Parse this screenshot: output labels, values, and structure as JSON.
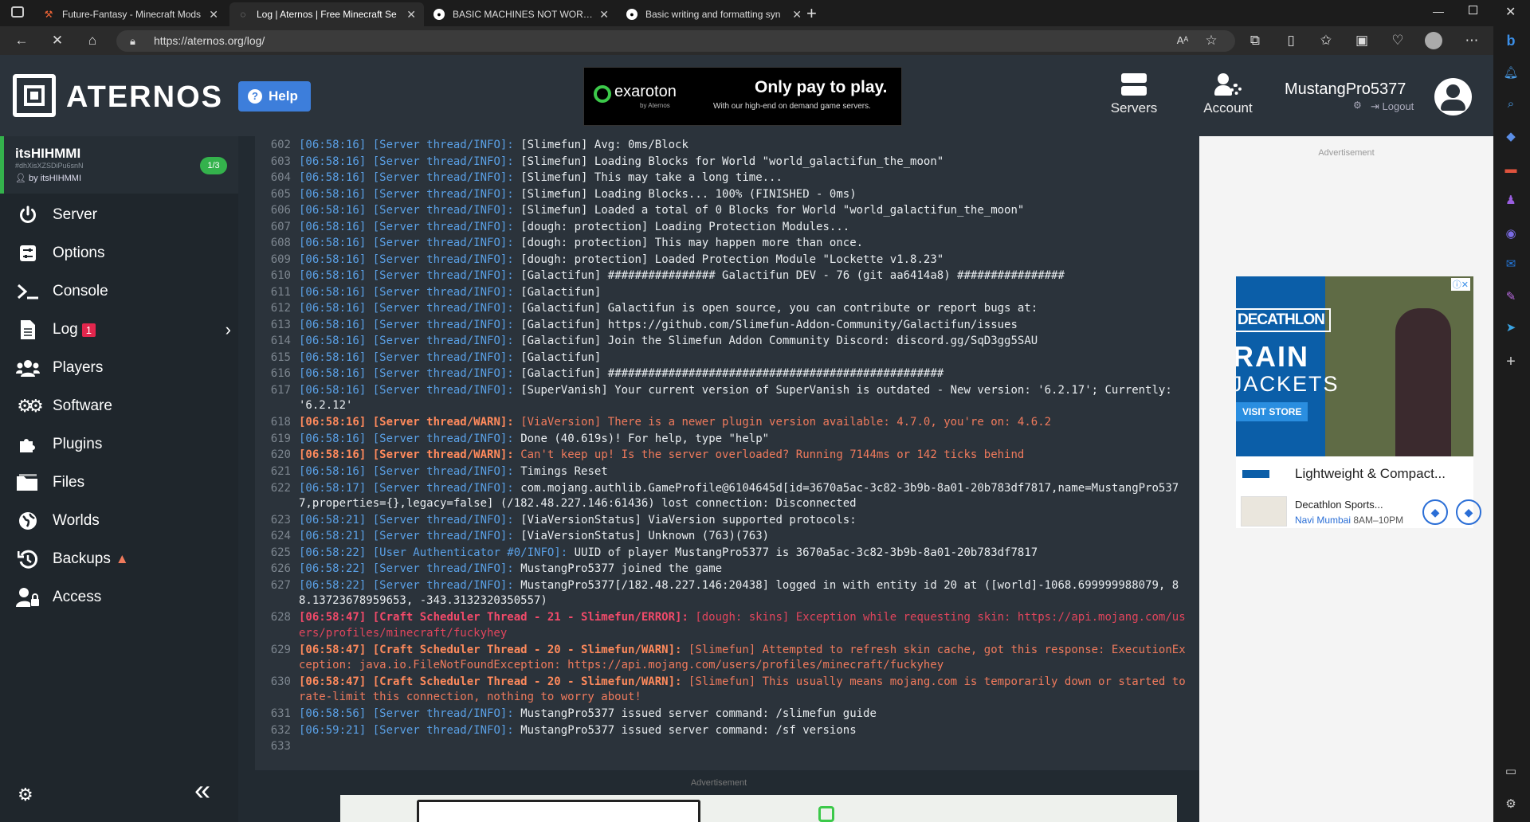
{
  "browser": {
    "tabs": [
      {
        "title": "Future-Fantasy - Minecraft Mods",
        "icon": "curseforge-icon"
      },
      {
        "title": "Log | Aternos | Free Minecraft Se",
        "icon": "loading-icon"
      },
      {
        "title": "BASIC MACHINES NOT WORKING",
        "icon": "github-icon"
      },
      {
        "title": "Basic writing and formatting syn",
        "icon": "github-icon"
      }
    ],
    "url": "https://aternos.org/log/"
  },
  "header": {
    "logo": "ATERNOS",
    "help": "Help",
    "ad": {
      "brand": "exaroton",
      "brand_sub": "by Aternos",
      "headline": "Only pay to play.",
      "sub": "With our high-end on demand game servers."
    },
    "nav": {
      "servers": "Servers",
      "account": "Account"
    },
    "user": {
      "name": "MustangPro5377",
      "logout": "Logout"
    }
  },
  "server": {
    "name": "itsHIHMMI",
    "id": "#dhXisXZSDiPu6snN",
    "owner": "by itsHIHMMI",
    "badge": "1/3"
  },
  "sidebar": {
    "items": [
      {
        "label": "Server",
        "icon": "power-icon"
      },
      {
        "label": "Options",
        "icon": "sliders-icon"
      },
      {
        "label": "Console",
        "icon": "terminal-icon"
      },
      {
        "label": "Log",
        "icon": "document-icon",
        "badge": "1"
      },
      {
        "label": "Players",
        "icon": "users-icon"
      },
      {
        "label": "Software",
        "icon": "gears-icon"
      },
      {
        "label": "Plugins",
        "icon": "puzzle-icon"
      },
      {
        "label": "Files",
        "icon": "folder-icon"
      },
      {
        "label": "Worlds",
        "icon": "globe-icon"
      },
      {
        "label": "Backups",
        "icon": "history-icon"
      },
      {
        "label": "Access",
        "icon": "user-lock-icon"
      }
    ]
  },
  "log": [
    {
      "n": "602",
      "t": "info",
      "ts": "[06:58:16]",
      "src": "[Server thread/INFO]:",
      "msg": "[Slimefun] Avg: 0ms/Block"
    },
    {
      "n": "603",
      "t": "info",
      "ts": "[06:58:16]",
      "src": "[Server thread/INFO]:",
      "msg": "[Slimefun] Loading Blocks for World \"world_galactifun_the_moon\""
    },
    {
      "n": "604",
      "t": "info",
      "ts": "[06:58:16]",
      "src": "[Server thread/INFO]:",
      "msg": "[Slimefun] This may take a long time..."
    },
    {
      "n": "605",
      "t": "info",
      "ts": "[06:58:16]",
      "src": "[Server thread/INFO]:",
      "msg": "[Slimefun] Loading Blocks... 100% (FINISHED - 0ms)"
    },
    {
      "n": "606",
      "t": "info",
      "ts": "[06:58:16]",
      "src": "[Server thread/INFO]:",
      "msg": "[Slimefun] Loaded a total of 0 Blocks for World \"world_galactifun_the_moon\""
    },
    {
      "n": "607",
      "t": "info",
      "ts": "[06:58:16]",
      "src": "[Server thread/INFO]:",
      "msg": "[dough: protection] Loading Protection Modules..."
    },
    {
      "n": "608",
      "t": "info",
      "ts": "[06:58:16]",
      "src": "[Server thread/INFO]:",
      "msg": "[dough: protection] This may happen more than once."
    },
    {
      "n": "609",
      "t": "info",
      "ts": "[06:58:16]",
      "src": "[Server thread/INFO]:",
      "msg": "[dough: protection] Loaded Protection Module \"Lockette v1.8.23\""
    },
    {
      "n": "610",
      "t": "info",
      "ts": "[06:58:16]",
      "src": "[Server thread/INFO]:",
      "msg": "[Galactifun] ################ Galactifun DEV - 76 (git aa6414a8) ################"
    },
    {
      "n": "611",
      "t": "info",
      "ts": "[06:58:16]",
      "src": "[Server thread/INFO]:",
      "msg": "[Galactifun]"
    },
    {
      "n": "612",
      "t": "info",
      "ts": "[06:58:16]",
      "src": "[Server thread/INFO]:",
      "msg": "[Galactifun] Galactifun is open source, you can contribute or report bugs at:"
    },
    {
      "n": "613",
      "t": "info",
      "ts": "[06:58:16]",
      "src": "[Server thread/INFO]:",
      "msg": "[Galactifun] https://github.com/Slimefun-Addon-Community/Galactifun/issues"
    },
    {
      "n": "614",
      "t": "info",
      "ts": "[06:58:16]",
      "src": "[Server thread/INFO]:",
      "msg": "[Galactifun] Join the Slimefun Addon Community Discord: discord.gg/SqD3gg5SAU"
    },
    {
      "n": "615",
      "t": "info",
      "ts": "[06:58:16]",
      "src": "[Server thread/INFO]:",
      "msg": "[Galactifun]"
    },
    {
      "n": "616",
      "t": "info",
      "ts": "[06:58:16]",
      "src": "[Server thread/INFO]:",
      "msg": "[Galactifun] ##################################################"
    },
    {
      "n": "617",
      "t": "info",
      "ts": "[06:58:16]",
      "src": "[Server thread/INFO]:",
      "msg": "[SuperVanish] Your current version of SuperVanish is outdated - New version: '6.2.17'; Currently: '6.2.12'"
    },
    {
      "n": "618",
      "t": "warn",
      "ts": "[06:58:16]",
      "src": "[Server thread/WARN]:",
      "msg": "[ViaVersion] There is a newer plugin version available: 4.7.0, you're on: 4.6.2"
    },
    {
      "n": "619",
      "t": "info",
      "ts": "[06:58:16]",
      "src": "[Server thread/INFO]:",
      "msg": "Done (40.619s)! For help, type \"help\""
    },
    {
      "n": "620",
      "t": "warn",
      "ts": "[06:58:16]",
      "src": "[Server thread/WARN]:",
      "msg": "Can't keep up! Is the server overloaded? Running 7144ms or 142 ticks behind"
    },
    {
      "n": "621",
      "t": "info",
      "ts": "[06:58:16]",
      "src": "[Server thread/INFO]:",
      "msg": "Timings Reset"
    },
    {
      "n": "622",
      "t": "info",
      "ts": "[06:58:17]",
      "src": "[Server thread/INFO]:",
      "msg": "com.mojang.authlib.GameProfile@6104645d[id=3670a5ac-3c82-3b9b-8a01-20b783df7817,name=MustangPro5377,properties={},legacy=false] (/182.48.227.146:61436) lost connection: Disconnected"
    },
    {
      "n": "623",
      "t": "info",
      "ts": "[06:58:21]",
      "src": "[Server thread/INFO]:",
      "msg": "[ViaVersionStatus] ViaVersion supported protocols:"
    },
    {
      "n": "624",
      "t": "info",
      "ts": "[06:58:21]",
      "src": "[Server thread/INFO]:",
      "msg": "[ViaVersionStatus] Unknown (763)(763)"
    },
    {
      "n": "625",
      "t": "info",
      "ts": "[06:58:22]",
      "src": "[User Authenticator #0/INFO]:",
      "msg": "UUID of player MustangPro5377 is 3670a5ac-3c82-3b9b-8a01-20b783df7817"
    },
    {
      "n": "626",
      "t": "info",
      "ts": "[06:58:22]",
      "src": "[Server thread/INFO]:",
      "msg": "MustangPro5377 joined the game"
    },
    {
      "n": "627",
      "t": "info",
      "ts": "[06:58:22]",
      "src": "[Server thread/INFO]:",
      "msg": "MustangPro5377[/182.48.227.146:20438] logged in with entity id 20 at ([world]-1068.699999988079, 88.13723678959653, -343.3132320350557)"
    },
    {
      "n": "628",
      "t": "err",
      "ts": "[06:58:47]",
      "src": "[Craft Scheduler Thread - 21 - Slimefun/ERROR]:",
      "msg": "[dough: skins] Exception while requesting skin: https://api.mojang.com/users/profiles/minecraft/fuckyhey"
    },
    {
      "n": "629",
      "t": "warn",
      "ts": "[06:58:47]",
      "src": "[Craft Scheduler Thread - 20 - Slimefun/WARN]:",
      "msg": "[Slimefun] Attempted to refresh skin cache, got this response: ExecutionException: java.io.FileNotFoundException: https://api.mojang.com/users/profiles/minecraft/fuckyhey"
    },
    {
      "n": "630",
      "t": "warn",
      "ts": "[06:58:47]",
      "src": "[Craft Scheduler Thread - 20 - Slimefun/WARN]:",
      "msg": "[Slimefun] This usually means mojang.com is temporarily down or started to rate-limit this connection, nothing to worry about!"
    },
    {
      "n": "631",
      "t": "info",
      "ts": "[06:58:56]",
      "src": "[Server thread/INFO]:",
      "msg": "MustangPro5377 issued server command: /slimefun guide"
    },
    {
      "n": "632",
      "t": "info",
      "ts": "[06:59:21]",
      "src": "[Server thread/INFO]:",
      "msg": "MustangPro5377 issued server command: /sf versions"
    },
    {
      "n": "633",
      "t": "info",
      "ts": "",
      "src": "",
      "msg": ""
    }
  ],
  "ads": {
    "label": "Advertisement",
    "right": {
      "brand": "DECATHLON",
      "line1": "RAIN",
      "line2": "JACKETS",
      "cta": "VISIT STORE",
      "title": "Lightweight & Compact...",
      "store": "Decathlon Sports...",
      "location": "Navi Mumbai",
      "hours": "8AM–10PM"
    }
  },
  "colors": {
    "accent": "#3d7edb",
    "info_ts": "#5aa0e6",
    "warn": "#ef7a5c",
    "error": "#e0455c",
    "online": "#34b24c",
    "badge_red": "#e2264d"
  }
}
